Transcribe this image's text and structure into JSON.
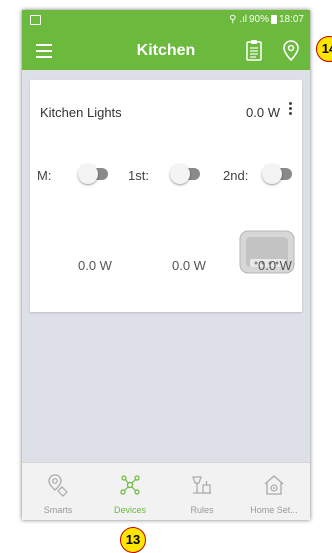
{
  "statusbar": {
    "signal": "⚲ .ıl",
    "battery": "90%",
    "time": "18:07"
  },
  "header": {
    "title": "Kitchen"
  },
  "card": {
    "name": "Kitchen Lights",
    "power": "0.0 W",
    "switches": [
      {
        "label": "M:",
        "state": "off"
      },
      {
        "label": "1st:",
        "state": "off"
      },
      {
        "label": "2nd:",
        "state": "off"
      }
    ],
    "watts": [
      "0.0 W",
      "0.0 W",
      "0.0 W"
    ]
  },
  "nav": [
    {
      "label": "Smarts",
      "active": false
    },
    {
      "label": "Devices",
      "active": true
    },
    {
      "label": "Rules",
      "active": false
    },
    {
      "label": "Home Set...",
      "active": false
    }
  ],
  "badges": {
    "bottom": "13",
    "top": "14"
  },
  "colors": {
    "accent": "#6bb93d",
    "badge": "#ffe600",
    "badge_border": "#c00000"
  }
}
